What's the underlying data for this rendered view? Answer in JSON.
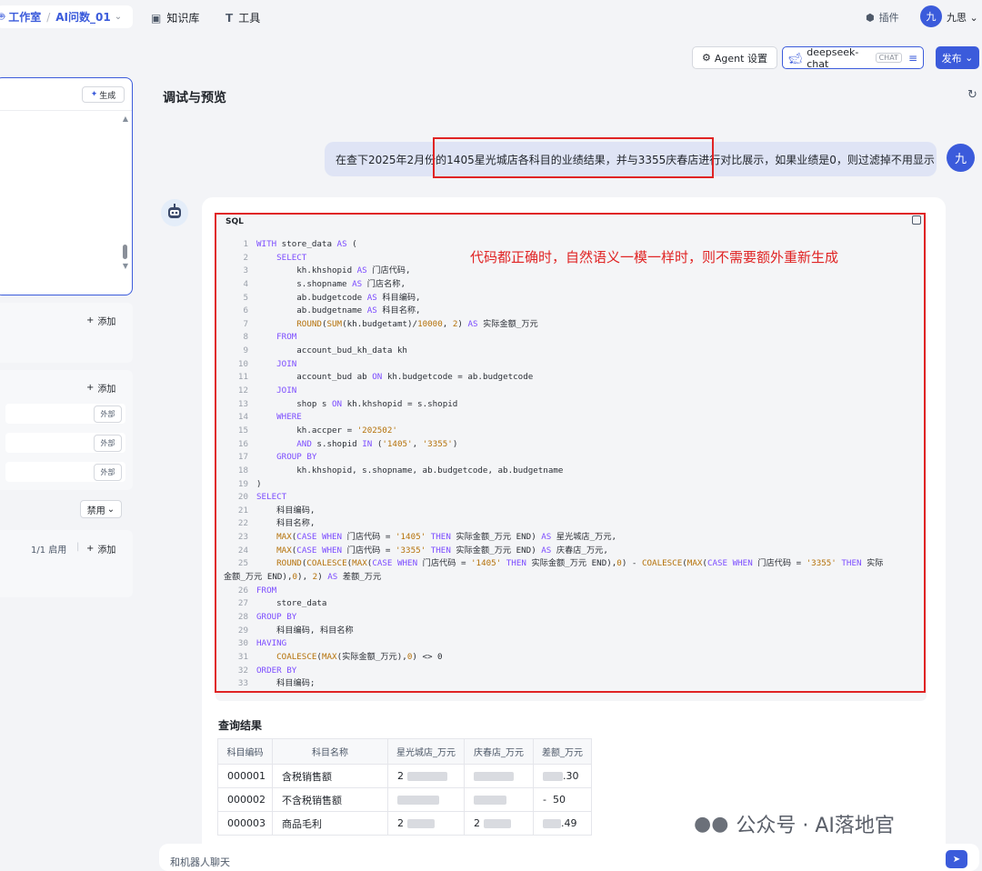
{
  "topbar": {
    "studio": "工作室",
    "project": "AI问数_01",
    "nav_knowledge": "知识库",
    "nav_tools": "工具",
    "plugin": "插件",
    "avatar_char": "九",
    "user_name": "九思"
  },
  "toolbar": {
    "agent_settings": "Agent 设置",
    "model_name": "deepseek-chat",
    "model_tag": "CHAT",
    "publish": "发布"
  },
  "left_panel": {
    "generate_label": "生成",
    "add_label_1": "添加",
    "add_label_2": "添加",
    "ext_tags": [
      "外部",
      "外部",
      "外部"
    ],
    "disable_label": "禁用",
    "enabled_count": "1/1 启用",
    "add_label_3": "添加"
  },
  "main": {
    "title": "调试与预览",
    "user_message": "在查下2025年2月份的1405星光城店各科目的业绩结果，并与3355庆春店进行对比展示，如果业绩是0，则过滤掉不用显示",
    "user_avatar": "九",
    "annotation": "代码都正确时，自然语义一模一样时，则不需要额外重新生成",
    "sql_label": "SQL",
    "sql_lines": [
      "WITH store_data AS (",
      "    SELECT",
      "        kh.khshopid AS 门店代码,",
      "        s.shopname AS 门店名称,",
      "        ab.budgetcode AS 科目编码,",
      "        ab.budgetname AS 科目名称,",
      "        ROUND(SUM(kh.budgetamt)/10000, 2) AS 实际金额_万元",
      "    FROM",
      "        account_bud_kh_data kh",
      "    JOIN",
      "        account_bud ab ON kh.budgetcode = ab.budgetcode",
      "    JOIN",
      "        shop s ON kh.khshopid = s.shopid",
      "    WHERE",
      "        kh.accper = '202502'",
      "        AND s.shopid IN ('1405', '3355')",
      "    GROUP BY",
      "        kh.khshopid, s.shopname, ab.budgetcode, ab.budgetname",
      ")",
      "SELECT",
      "    科目编码,",
      "    科目名称,",
      "    MAX(CASE WHEN 门店代码 = '1405' THEN 实际金额_万元 END) AS 星光城店_万元,",
      "    MAX(CASE WHEN 门店代码 = '3355' THEN 实际金额_万元 END) AS 庆春店_万元,",
      "    ROUND(COALESCE(MAX(CASE WHEN 门店代码 = '1405' THEN 实际金额_万元 END),0) - COALESCE(MAX(CASE WHEN 门店代码 = '3355' THEN 实际",
      "FROM",
      "    store_data",
      "GROUP BY",
      "    科目编码, 科目名称",
      "HAVING",
      "    COALESCE(MAX(实际金额_万元),0) <> 0",
      "ORDER BY",
      "    科目编码;"
    ],
    "sql_wrap_25": "金额_万元 END),0), 2) AS 差额_万元",
    "result_title": "查询结果",
    "table_headers": [
      "科目编码",
      "科目名称",
      "星光城店_万元",
      "庆春店_万元",
      "差额_万元"
    ],
    "table_rows": [
      {
        "code": "000001",
        "name": "含税销售额",
        "a": "2",
        "b": "",
        "c": ".30"
      },
      {
        "code": "000002",
        "name": "不含税销售额",
        "a": "",
        "b": "",
        "c": "-  50"
      },
      {
        "code": "000003",
        "name": "商品毛利",
        "a": "2",
        "b": "2",
        "c": ".49"
      }
    ],
    "watermark": "公众号 · AI落地官",
    "input_placeholder": "和机器人聊天"
  }
}
